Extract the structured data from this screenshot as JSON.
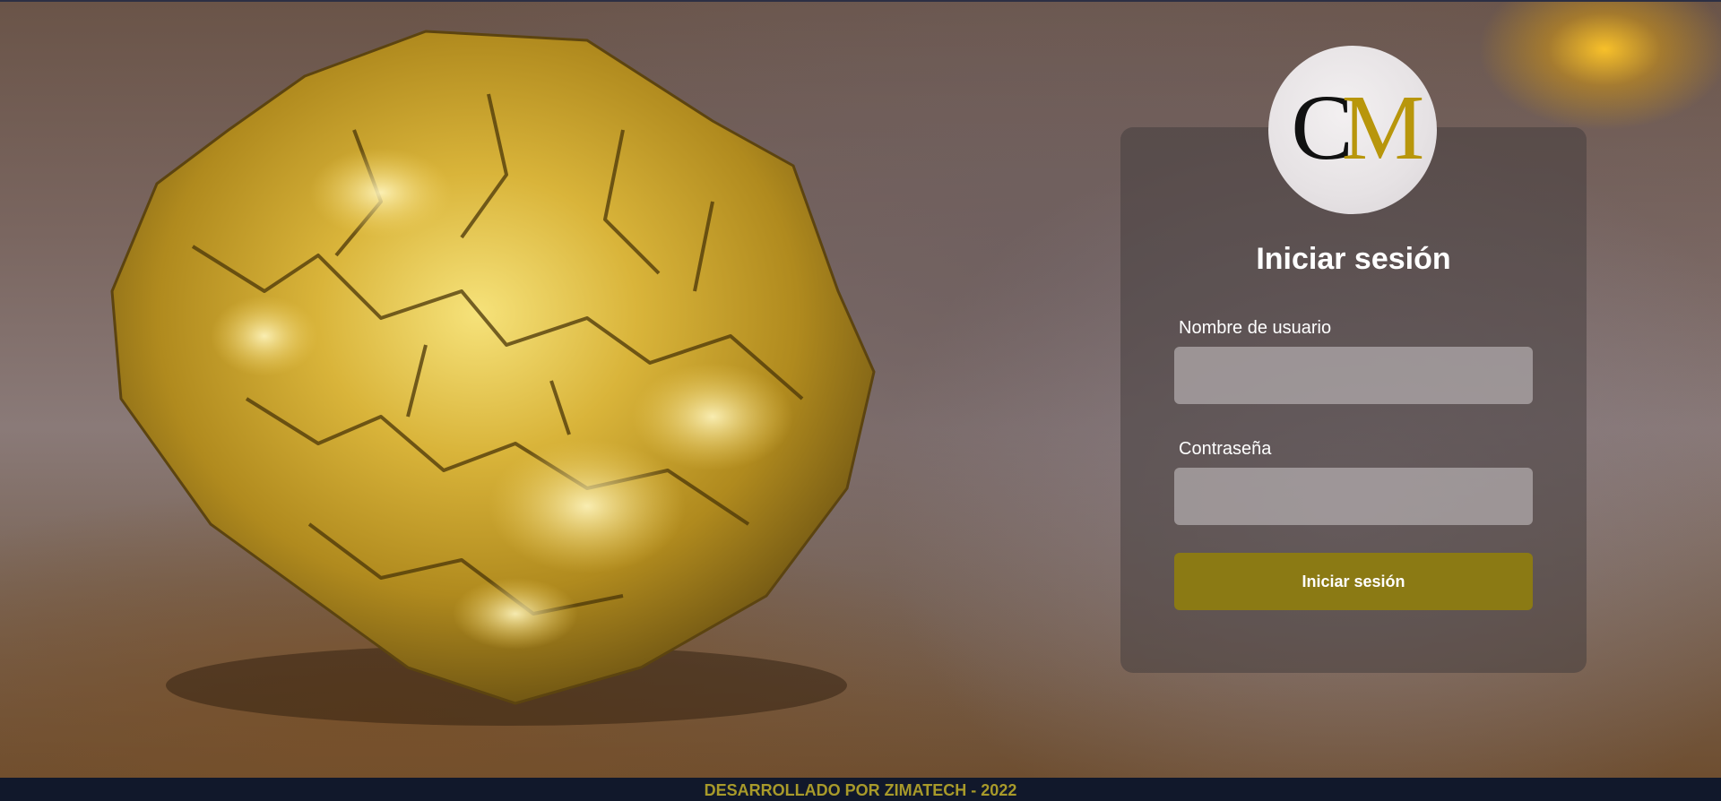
{
  "logo": {
    "letter1": "C",
    "letter2": "M",
    "color1": "#111111",
    "color2": "#b8960b"
  },
  "login": {
    "title": "Iniciar sesión",
    "username_label": "Nombre de usuario",
    "username_value": "",
    "password_label": "Contraseña",
    "password_value": "",
    "submit_label": "Iniciar sesión"
  },
  "footer": {
    "text": "DESARROLLADO POR ZIMATECH - 2022"
  },
  "colors": {
    "button": "#8b7a14",
    "footer_bg": "#11182b",
    "footer_text": "#a89a2a"
  }
}
